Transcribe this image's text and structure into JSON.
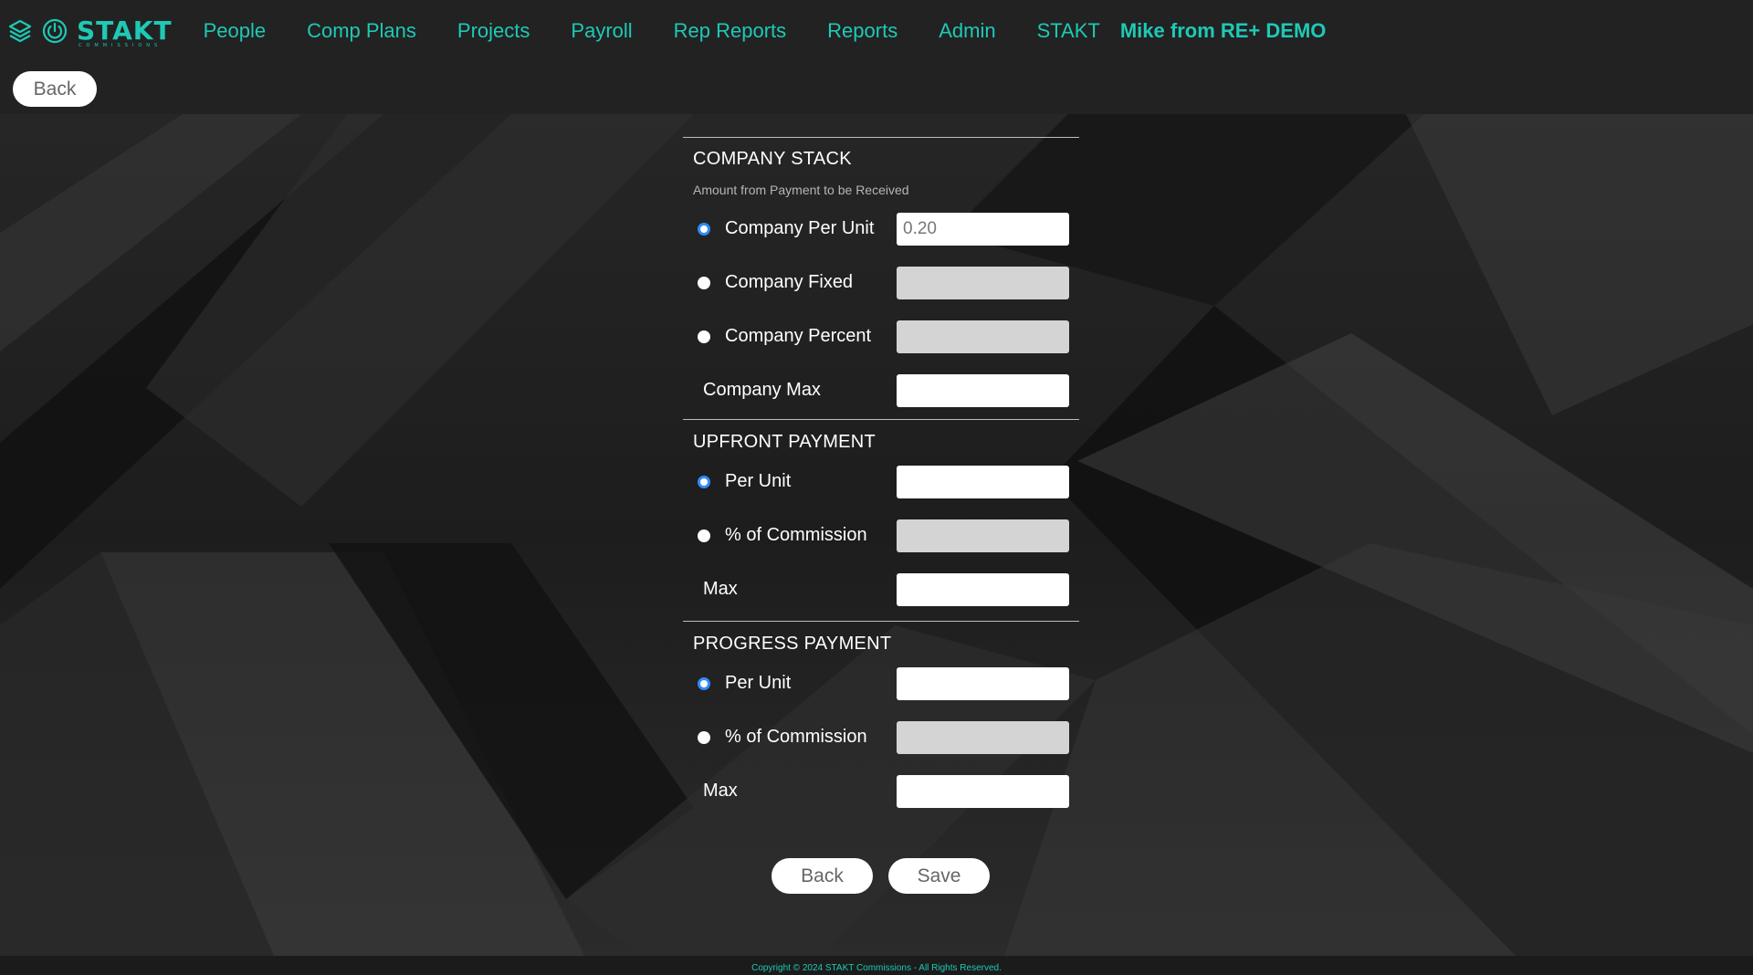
{
  "app": {
    "brand": "STAKT",
    "brand_sub": "COMMISSIONS",
    "brand_color": "#1ec9b5",
    "icons": [
      "layers-icon",
      "power-icon"
    ]
  },
  "nav": {
    "links": [
      "People",
      "Comp Plans",
      "Projects",
      "Payroll",
      "Rep Reports",
      "Reports",
      "Admin",
      "STAKT"
    ],
    "user": "Mike from  RE+ DEMO"
  },
  "back_top_label": "Back",
  "company_stack": {
    "title": "COMPANY STACK",
    "hint": "Amount from Payment to be Received",
    "per_unit_label": "Company Per Unit",
    "per_unit_value": "0.20",
    "fixed_label": "Company Fixed",
    "percent_label": "Company Percent",
    "max_label": "Company Max",
    "selected": "per_unit"
  },
  "upfront_payment": {
    "title": "UPFRONT PAYMENT",
    "per_unit_label": "Per Unit",
    "commission_label": "% of Commission",
    "max_label": "Max",
    "selected": "per_unit"
  },
  "progress_payment": {
    "title": "PROGRESS PAYMENT",
    "per_unit_label": "Per Unit",
    "commission_label": "% of Commission",
    "max_label": "Max",
    "selected": "per_unit"
  },
  "actions": {
    "back_label": "Back",
    "save_label": "Save"
  },
  "footer": {
    "copyright": "Copyright © 2024 STAKT Commissions - All Rights Reserved."
  }
}
